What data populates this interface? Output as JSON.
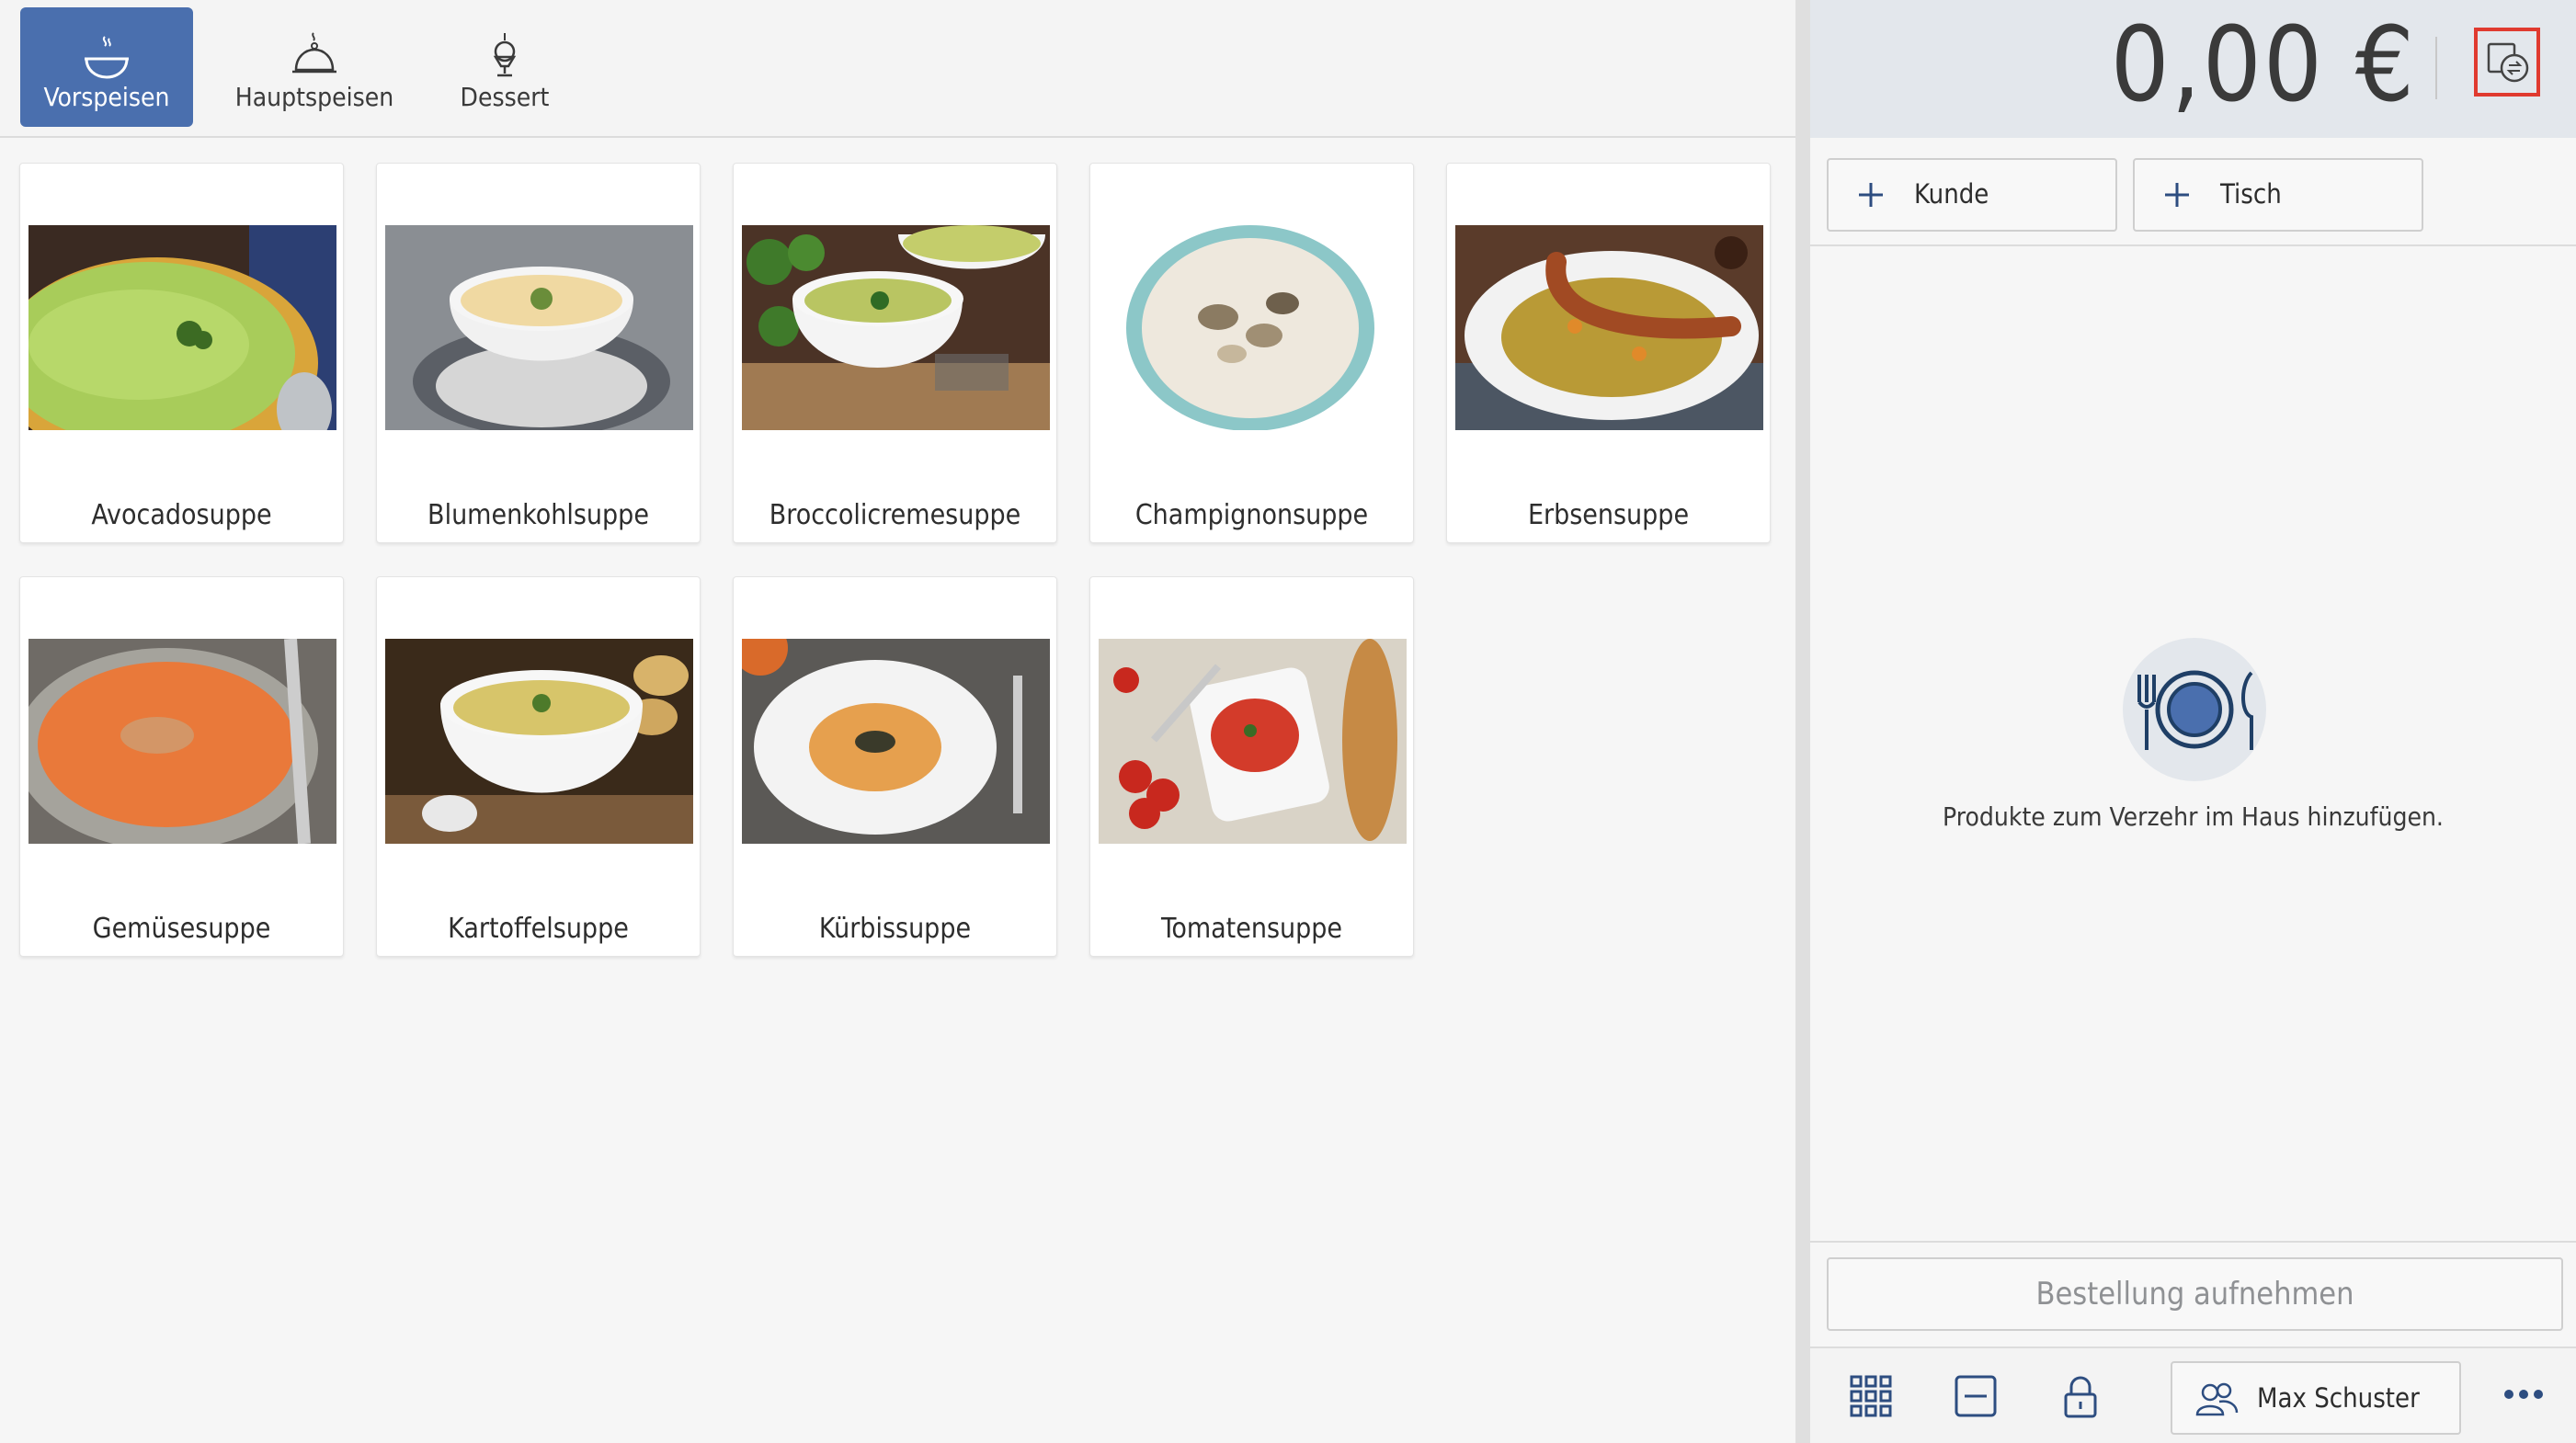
{
  "categories": [
    {
      "label": "Vorspeisen",
      "icon": "soup-bowl-icon",
      "active": true
    },
    {
      "label": "Hauptspeisen",
      "icon": "cloche-icon",
      "active": false
    },
    {
      "label": "Dessert",
      "icon": "ice-cream-icon",
      "active": false
    }
  ],
  "products": [
    {
      "name": "Avocadosuppe",
      "image": "green soup with parsley"
    },
    {
      "name": "Blumenkohlsuppe",
      "image": "cream cauliflower soup"
    },
    {
      "name": "Broccolicremesuppe",
      "image": "broccoli cream soup"
    },
    {
      "name": "Champignonsuppe",
      "image": "mushroom cream soup"
    },
    {
      "name": "Erbsensuppe",
      "image": "pea soup with sausage"
    },
    {
      "name": "Gemüsesuppe",
      "image": "orange vegetable soup"
    },
    {
      "name": "Kartoffelsuppe",
      "image": "potato soup"
    },
    {
      "name": "Kürbissuppe",
      "image": "pumpkin soup with seeds"
    },
    {
      "name": "Tomatensuppe",
      "image": "tomato soup with bread"
    }
  ],
  "cart": {
    "total": "0,00 €",
    "customer_button": "Kunde",
    "table_button": "Tisch",
    "empty_message": "Produkte zum Verzehr im Haus hinzufügen.",
    "order_button": "Bestellung aufnehmen"
  },
  "bottom": {
    "user_name": "Max Schuster",
    "icons": [
      "grid-icon",
      "minus-square-icon",
      "lock-icon",
      "users-icon",
      "more-icon"
    ]
  },
  "colors": {
    "accent": "#4a6fae",
    "highlight": "#e03a2f",
    "plate": "#1f3f66"
  }
}
